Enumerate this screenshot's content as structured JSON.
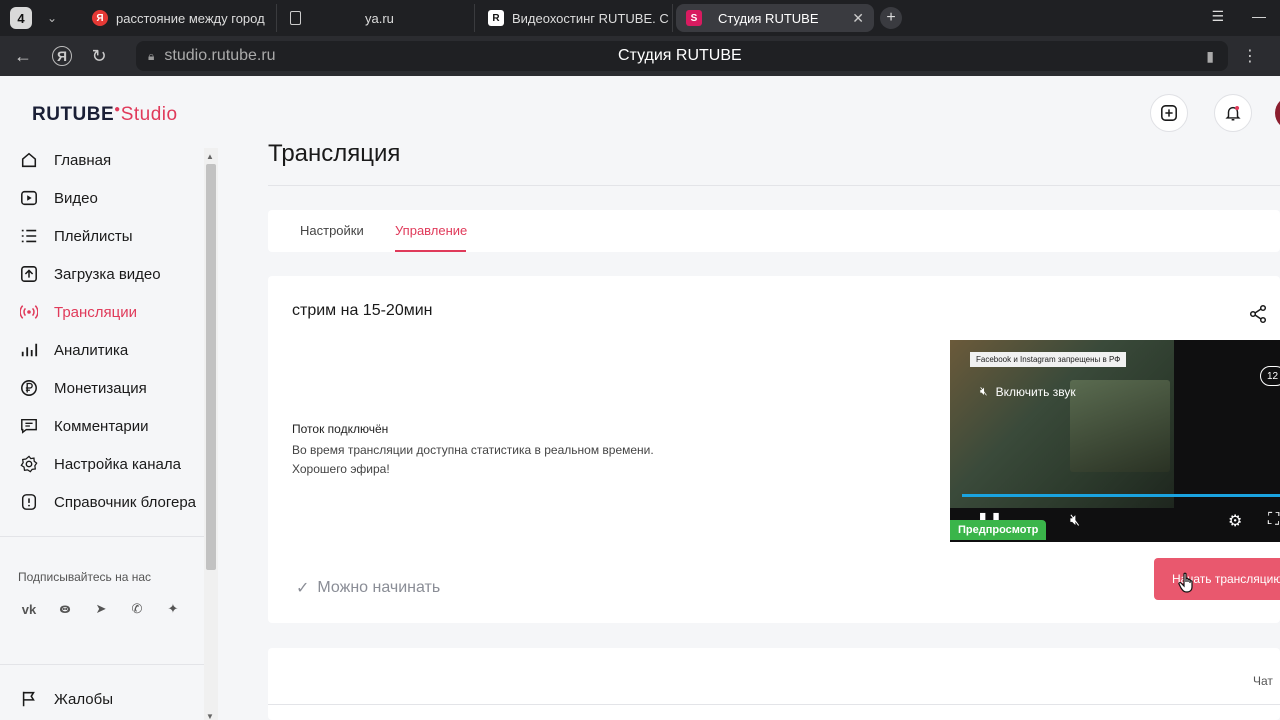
{
  "browser": {
    "tab_count": "4",
    "tabs": [
      {
        "label": "расстояние между город",
        "favicon": "Я"
      },
      {
        "label": "ya.ru",
        "favicon": "doc"
      },
      {
        "label": "Видеохостинг RUTUBE. С",
        "favicon": "R"
      },
      {
        "label": "Студия RUTUBE",
        "favicon": "S"
      }
    ],
    "url": "studio.rutube.ru",
    "page_title": "Студия RUTUBE"
  },
  "sidebar": {
    "logo_main": "RUTUBE",
    "logo_studio": "Studio",
    "items": [
      {
        "label": "Главная",
        "icon": "home-icon"
      },
      {
        "label": "Видео",
        "icon": "video-icon"
      },
      {
        "label": "Плейлисты",
        "icon": "playlist-icon"
      },
      {
        "label": "Загрузка видео",
        "icon": "upload-icon"
      },
      {
        "label": "Трансляции",
        "icon": "broadcast-icon"
      },
      {
        "label": "Аналитика",
        "icon": "analytics-icon"
      },
      {
        "label": "Монетизация",
        "icon": "ruble-icon"
      },
      {
        "label": "Комментарии",
        "icon": "comments-icon"
      },
      {
        "label": "Настройка канала",
        "icon": "gear-icon"
      },
      {
        "label": "Справочник блогера",
        "icon": "info-icon"
      }
    ],
    "subscribe_label": "Подписывайтесь на нас",
    "socials": [
      "vk-icon",
      "ok-icon",
      "telegram-icon",
      "viber-icon",
      "dzen-icon"
    ],
    "complaints": "Жалобы"
  },
  "main": {
    "title": "Трансляция",
    "tabs": [
      {
        "label": "Настройки"
      },
      {
        "label": "Управление"
      }
    ],
    "stream_name": "стрим на 15-20мин",
    "status": {
      "title": "Поток подключён",
      "line1": "Во время трансляции доступна статистика в реальном времени.",
      "line2": "Хорошего эфира!"
    },
    "ready_label": "Можно начинать",
    "player": {
      "banner": "Facebook и Instagram запрещены в РФ",
      "sound_label": "Включить звук",
      "age_badge": "12",
      "preview_badge": "Предпросмотр"
    },
    "start_button": "Начать трансляцию",
    "chat_label": "Чат"
  },
  "colors": {
    "accent": "#e03a5a",
    "button": "#e9586e",
    "preview_green": "#3ab54a",
    "progress_blue": "#1aa3e0"
  }
}
